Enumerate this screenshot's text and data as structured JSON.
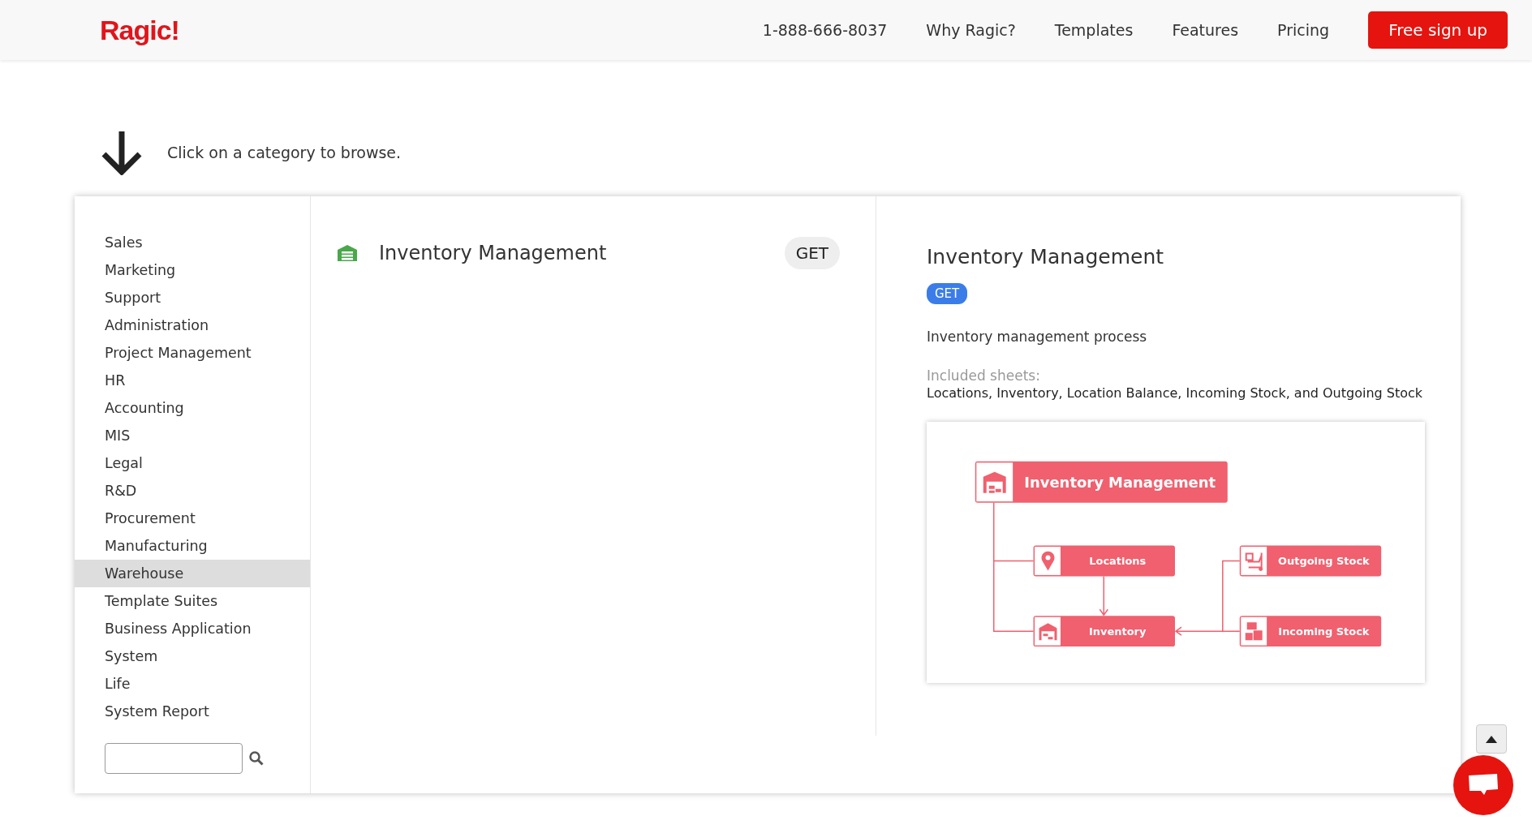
{
  "header": {
    "logo": "Ragic!",
    "nav": [
      "1-888-666-8037",
      "Why Ragic?",
      "Templates",
      "Features",
      "Pricing"
    ],
    "signup": "Free sign up"
  },
  "hint": "Click on a category to browse.",
  "sidebar": {
    "items": [
      {
        "label": "Sales",
        "selected": false
      },
      {
        "label": "Marketing",
        "selected": false
      },
      {
        "label": "Support",
        "selected": false
      },
      {
        "label": "Administration",
        "selected": false
      },
      {
        "label": "Project Management",
        "selected": false
      },
      {
        "label": "HR",
        "selected": false
      },
      {
        "label": "Accounting",
        "selected": false
      },
      {
        "label": "MIS",
        "selected": false
      },
      {
        "label": "Legal",
        "selected": false
      },
      {
        "label": "R&D",
        "selected": false
      },
      {
        "label": "Procurement",
        "selected": false
      },
      {
        "label": "Manufacturing",
        "selected": false
      },
      {
        "label": "Warehouse",
        "selected": true
      },
      {
        "label": "Template Suites",
        "selected": false
      },
      {
        "label": "Business Application",
        "selected": false
      },
      {
        "label": "System",
        "selected": false
      },
      {
        "label": "Life",
        "selected": false
      },
      {
        "label": "System Report",
        "selected": false
      }
    ]
  },
  "templates": [
    {
      "name": "Inventory Management",
      "button": "GET"
    }
  ],
  "detail": {
    "title": "Inventory Management",
    "button": "GET",
    "description": "Inventory management process",
    "sheets_label": "Included sheets:",
    "sheets": "Locations, Inventory, Location Balance, Incoming Stock, and Outgoing Stock",
    "diagram": {
      "title": "Inventory Management",
      "nodes": [
        "Locations",
        "Outgoing Stock",
        "Inventory",
        "Incoming Stock"
      ]
    }
  }
}
